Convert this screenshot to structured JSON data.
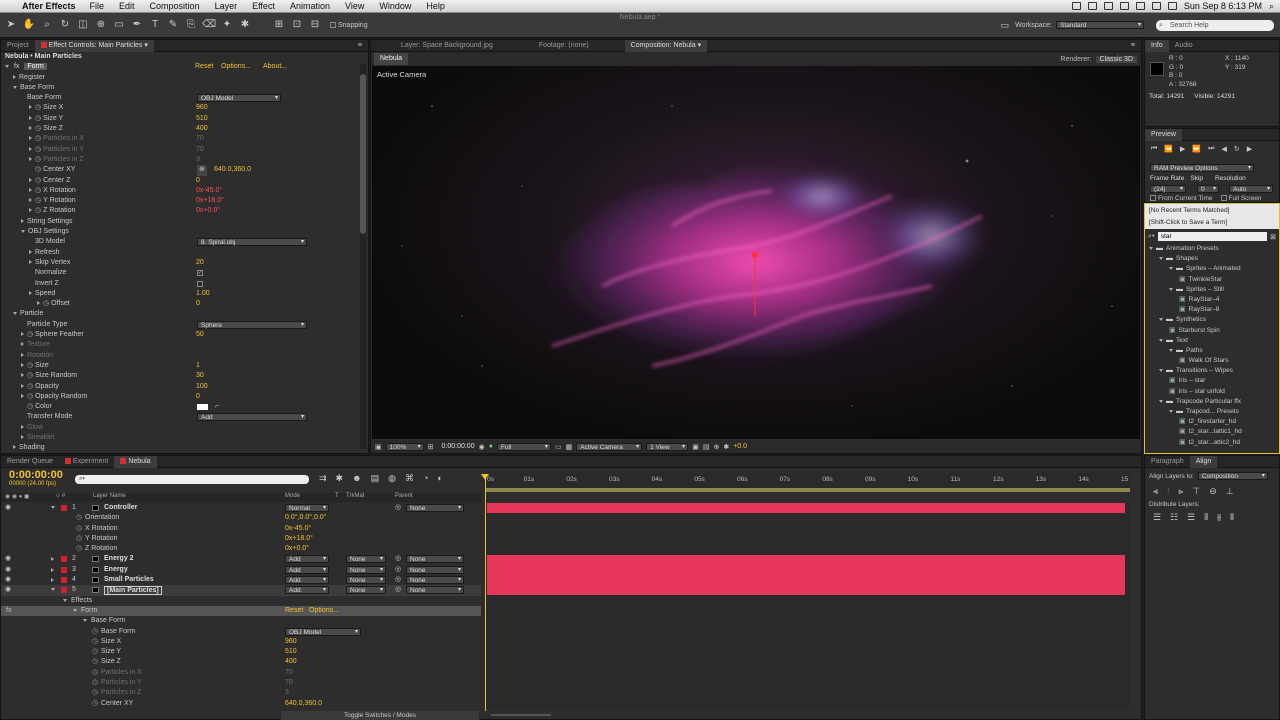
{
  "menubar": {
    "app": "After Effects",
    "items": [
      "File",
      "Edit",
      "Composition",
      "Layer",
      "Effect",
      "Animation",
      "View",
      "Window",
      "Help"
    ],
    "clock": "Sun Sep 8  6:13 PM"
  },
  "window": {
    "title": "Nebula.aep *"
  },
  "toolbar": {
    "snapping": "Snapping",
    "workspace_label": "Workspace:",
    "workspace_value": "Standard",
    "search_placeholder": "Search Help"
  },
  "project_panel": {
    "tab_project": "Project",
    "tab_effect_controls": "Effect Controls: Main Particles",
    "layer_path": "Nebula • Main Particles",
    "fx_name": "Form",
    "fx_reset": "Reset",
    "fx_options": "Options...",
    "fx_about": "About...",
    "rows": [
      {
        "label": "Register",
        "indent": 1,
        "tri": "closed"
      },
      {
        "label": "Base Form",
        "indent": 1,
        "tri": "open"
      },
      {
        "label": "Base Form",
        "indent": 2,
        "dropdown": "OBJ Model"
      },
      {
        "label": "Size X",
        "indent": 3,
        "tri": "closed",
        "sw": true,
        "value": "960",
        "vclass": "yl"
      },
      {
        "label": "Size Y",
        "indent": 3,
        "tri": "closed",
        "sw": true,
        "value": "510",
        "vclass": "yl"
      },
      {
        "label": "Size Z",
        "indent": 3,
        "tri": "closed",
        "sw": true,
        "value": "400",
        "vclass": "yl"
      },
      {
        "label": "Particles in X",
        "indent": 3,
        "tri": "closed",
        "sw": true,
        "value": "70",
        "dim": true
      },
      {
        "label": "Particles in Y",
        "indent": 3,
        "tri": "closed",
        "sw": true,
        "value": "70",
        "dim": true
      },
      {
        "label": "Particles in Z",
        "indent": 3,
        "tri": "closed",
        "sw": true,
        "value": "3",
        "dim": true
      },
      {
        "label": "Center XY",
        "indent": 3,
        "sw": true,
        "value": "640.0,360.0",
        "vclass": "yl",
        "target": true
      },
      {
        "label": "Center Z",
        "indent": 3,
        "tri": "closed",
        "sw": true,
        "value": "0",
        "vclass": "yl"
      },
      {
        "label": "X Rotation",
        "indent": 3,
        "tri": "closed",
        "sw": true,
        "value": "0x-45.0°",
        "vclass": "red"
      },
      {
        "label": "Y Rotation",
        "indent": 3,
        "tri": "closed",
        "sw": true,
        "value": "0x+18.0°",
        "vclass": "red"
      },
      {
        "label": "Z Rotation",
        "indent": 3,
        "tri": "closed",
        "sw": true,
        "value": "0x+0.0°",
        "vclass": "red"
      },
      {
        "label": "String Settings",
        "indent": 2,
        "tri": "closed"
      },
      {
        "label": "OBJ Settings",
        "indent": 2,
        "tri": "open"
      },
      {
        "label": "3D Model",
        "indent": 3,
        "dropdown": "8. Spiral.obj"
      },
      {
        "label": "Refresh",
        "indent": 3,
        "tri": "closed"
      },
      {
        "label": "Skip Vertex",
        "indent": 3,
        "tri": "closed",
        "value": "20",
        "vclass": "yl"
      },
      {
        "label": "Normalize",
        "indent": 3,
        "check": "✓"
      },
      {
        "label": "Invert Z",
        "indent": 3,
        "check": ""
      },
      {
        "label": "Speed",
        "indent": 3,
        "tri": "closed",
        "value": "1.00",
        "vclass": "yl"
      },
      {
        "label": "Offset",
        "indent": 4,
        "tri": "closed",
        "sw": true,
        "value": "0",
        "vclass": "yl"
      },
      {
        "label": "Particle",
        "indent": 1,
        "tri": "open"
      },
      {
        "label": "Particle Type",
        "indent": 2,
        "dropdown": "Sphere"
      },
      {
        "label": "Sphere Feather",
        "indent": 2,
        "tri": "closed",
        "sw": true,
        "value": "50",
        "vclass": "yl"
      },
      {
        "label": "Texture",
        "indent": 2,
        "tri": "closed",
        "dim": true
      },
      {
        "label": "Rotation",
        "indent": 2,
        "tri": "closed",
        "dim": true
      },
      {
        "label": "Size",
        "indent": 2,
        "tri": "closed",
        "sw": true,
        "value": "1",
        "vclass": "yl"
      },
      {
        "label": "Size Random",
        "indent": 2,
        "tri": "closed",
        "sw": true,
        "value": "30",
        "vclass": "yl"
      },
      {
        "label": "Opacity",
        "indent": 2,
        "tri": "closed",
        "sw": true,
        "value": "100",
        "vclass": "yl"
      },
      {
        "label": "Opacity Random",
        "indent": 2,
        "tri": "closed",
        "sw": true,
        "value": "0",
        "vclass": "yl"
      },
      {
        "label": "Color",
        "indent": 2,
        "sw": true,
        "color": true
      },
      {
        "label": "Transfer Mode",
        "indent": 2,
        "dropdown": "Add"
      },
      {
        "label": "Glow",
        "indent": 2,
        "tri": "closed",
        "dim": true
      },
      {
        "label": "Streaklet",
        "indent": 2,
        "tri": "closed",
        "dim": true
      },
      {
        "label": "Shading",
        "indent": 1,
        "tri": "closed"
      }
    ]
  },
  "comp_panel": {
    "tab_layer": "Layer: Space Background.jpg",
    "tab_footage": "Footage: (none)",
    "tab_comp": "Composition: Nebula",
    "comp_name": "Nebula",
    "renderer_label": "Renderer:",
    "renderer_value": "Classic 3D",
    "active_camera": "Active Camera",
    "zoom": "100%",
    "timecode": "0:00:00:00",
    "resolution": "Full",
    "camera": "Active Camera",
    "views": "1 View",
    "exposure": "+0.0"
  },
  "info_panel": {
    "tab_info": "Info",
    "tab_audio": "Audio",
    "r": "R : 0",
    "g": "G : 0",
    "b": "B : 0",
    "a": "A : 32768",
    "x": "X : 1140",
    "y": "Y : 319",
    "total": "Total: 14291",
    "visible": "Visible: 14291"
  },
  "preview_panel": {
    "tab": "Preview",
    "ram_options": "RAM Preview Options",
    "frame_rate_label": "Frame Rate",
    "skip_label": "Skip",
    "resolution_label": "Resolution",
    "frame_rate": "(24)",
    "skip": "0",
    "resolution": "Auto",
    "from_current": "From Current Time",
    "full_screen": "Full Screen"
  },
  "presets_panel": {
    "no_recent": "[No Recent Terms Matched]",
    "save_term": "[Shift-Click to Save a Term]",
    "search_value": "star",
    "tree": [
      {
        "label": "Animation Presets",
        "indent": 0,
        "folder": true
      },
      {
        "label": "Shapes",
        "indent": 1,
        "folder": true
      },
      {
        "label": "Sprites – Animated",
        "indent": 2,
        "folder": true
      },
      {
        "label": "TwinkleStar",
        "indent": 3
      },
      {
        "label": "Sprites – Still",
        "indent": 2,
        "folder": true
      },
      {
        "label": "RayStar–4",
        "indent": 3
      },
      {
        "label": "RayStar–8",
        "indent": 3
      },
      {
        "label": "Synthetics",
        "indent": 1,
        "folder": true
      },
      {
        "label": "Starburst Spin",
        "indent": 2
      },
      {
        "label": "Text",
        "indent": 1,
        "folder": true
      },
      {
        "label": "Paths",
        "indent": 2,
        "folder": true
      },
      {
        "label": "Walk Of Stars",
        "indent": 3
      },
      {
        "label": "Transitions – Wipes",
        "indent": 1,
        "folder": true
      },
      {
        "label": "Iris – star",
        "indent": 2
      },
      {
        "label": "Iris – star unfold",
        "indent": 2
      },
      {
        "label": "Trapcode Particular ffx",
        "indent": 1,
        "folder": true
      },
      {
        "label": "Trapcod... Presets",
        "indent": 2,
        "folder": true
      },
      {
        "label": "t2_firestarter_hd",
        "indent": 3
      },
      {
        "label": "t2_star...tattic1_hd",
        "indent": 3
      },
      {
        "label": "t2_star...attic2_hd",
        "indent": 3
      }
    ]
  },
  "timeline": {
    "tab_render": "Render Queue",
    "tab_experiment": "Experiment",
    "tab_nebula": "Nebula",
    "timecode": "0:00:00:00",
    "frame_info": "00000 (24.00 fps)",
    "search_placeholder": "",
    "col_layer_name": "Layer Name",
    "col_mode": "Mode",
    "col_t": "T",
    "col_trkmat": "TrkMat",
    "col_parent": "Parent",
    "ruler": [
      "0s",
      "01s",
      "02s",
      "03s",
      "04s",
      "05s",
      "06s",
      "07s",
      "08s",
      "09s",
      "10s",
      "11s",
      "12s",
      "13s",
      "14s",
      "15"
    ],
    "toggle": "Toggle Switches / Modes",
    "rows": [
      {
        "num": "1",
        "name": "Controller",
        "mode": "Normal",
        "parent": "None",
        "layer": true,
        "bar": true,
        "open": true
      },
      {
        "name": "Orientation",
        "value": "0.0°,0.0°,0.0°",
        "indent": 1
      },
      {
        "name": "X Rotation",
        "value": "0x-45.0°",
        "indent": 1
      },
      {
        "name": "Y Rotation",
        "value": "0x+18.0°",
        "indent": 1
      },
      {
        "name": "Z Rotation",
        "value": "0x+0.0°",
        "indent": 1
      },
      {
        "num": "2",
        "name": "Energy 2",
        "mode": "Add",
        "trk": "None",
        "parent": "None",
        "layer": true,
        "bar": true
      },
      {
        "num": "3",
        "name": "Energy",
        "mode": "Add",
        "trk": "None",
        "parent": "None",
        "layer": true,
        "bar": true
      },
      {
        "num": "4",
        "name": "Small Particles",
        "mode": "Add",
        "trk": "None",
        "parent": "None",
        "layer": true,
        "bar": true
      },
      {
        "num": "5",
        "name": "[Main Particles]",
        "mode": "Add",
        "trk": "None",
        "parent": "None",
        "layer": true,
        "bar": true,
        "selected": true,
        "open": true
      },
      {
        "name": "Effects",
        "indent": 1,
        "tri": "open"
      },
      {
        "name": "Form",
        "indent": 2,
        "tri": "open",
        "fx": true,
        "reset": "Reset",
        "options": "Options..."
      },
      {
        "name": "Base Form",
        "indent": 3,
        "tri": "open"
      },
      {
        "name": "Base Form",
        "indent": 4,
        "dropdown": "OBJ Model"
      },
      {
        "name": "Size X",
        "value": "960",
        "indent": 4
      },
      {
        "name": "Size Y",
        "value": "510",
        "indent": 4
      },
      {
        "name": "Size Z",
        "value": "400",
        "indent": 4
      },
      {
        "name": "Particles in X",
        "value": "70",
        "indent": 4,
        "dim": true
      },
      {
        "name": "Particles in Y",
        "value": "70",
        "indent": 4,
        "dim": true
      },
      {
        "name": "Particles in Z",
        "value": "3",
        "indent": 4,
        "dim": true
      },
      {
        "name": "Center XY",
        "value": "640.0,360.0",
        "indent": 4
      }
    ]
  },
  "paragraph_panel": {
    "tab_paragraph": "Paragraph",
    "tab_align": "Align",
    "align_to_label": "Align Layers to:",
    "align_to_value": "Composition",
    "distribute": "Distribute Layers:"
  },
  "colors": {
    "track": "#e8365a",
    "accent_yellow": "#f2c12e",
    "nebula_pink": "#d43aa8"
  }
}
